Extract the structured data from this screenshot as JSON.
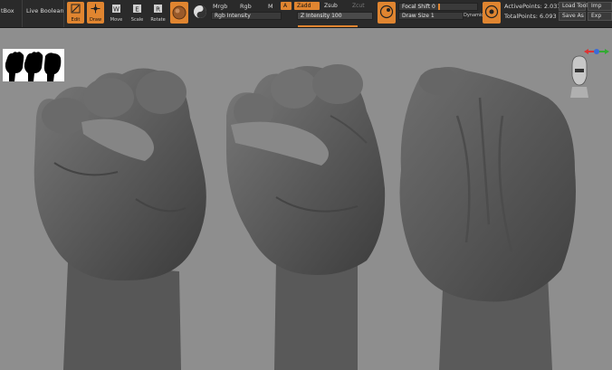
{
  "toolbar": {
    "tbox_label": "tBox",
    "live_boolean_label": "Live Boolean",
    "tools": [
      {
        "label": "Edit",
        "active": true
      },
      {
        "label": "Draw",
        "active": true
      },
      {
        "label": "Move",
        "active": false
      },
      {
        "label": "Scale",
        "active": false
      },
      {
        "label": "Rotate",
        "active": false
      }
    ],
    "mrgb_label": "Mrgb",
    "rgb_label": "Rgb",
    "m_label": "M",
    "a_label": "A",
    "zadd_label": "Zadd",
    "zsub_label": "Zsub",
    "zcut_label": "Zcut",
    "rgb_intensity_label": "Rgb Intensity",
    "z_intensity_label": "Z Intensity",
    "z_intensity_value": "100",
    "focal_shift_label": "Focal Shift",
    "focal_shift_value": "0",
    "draw_size_label": "Draw Size",
    "draw_size_value": "1",
    "dynamic_label": "Dynamic",
    "active_points_label": "ActivePoints:",
    "active_points_value": "2.031 Mil",
    "total_points_label": "TotalPoints:",
    "total_points_value": "6.093 Mil",
    "load_tool_label": "Load Tool",
    "save_as_label": "Save As",
    "imp_label": "Imp",
    "exp_label": "Exp"
  },
  "colors": {
    "accent": "#e08530",
    "toolbar_bg": "#2a2a2a",
    "canvas_bg": "#8e8e8e",
    "clay": "#555555"
  },
  "canvas": {
    "views": [
      "front-view",
      "three-quarter-view",
      "back-view"
    ]
  }
}
